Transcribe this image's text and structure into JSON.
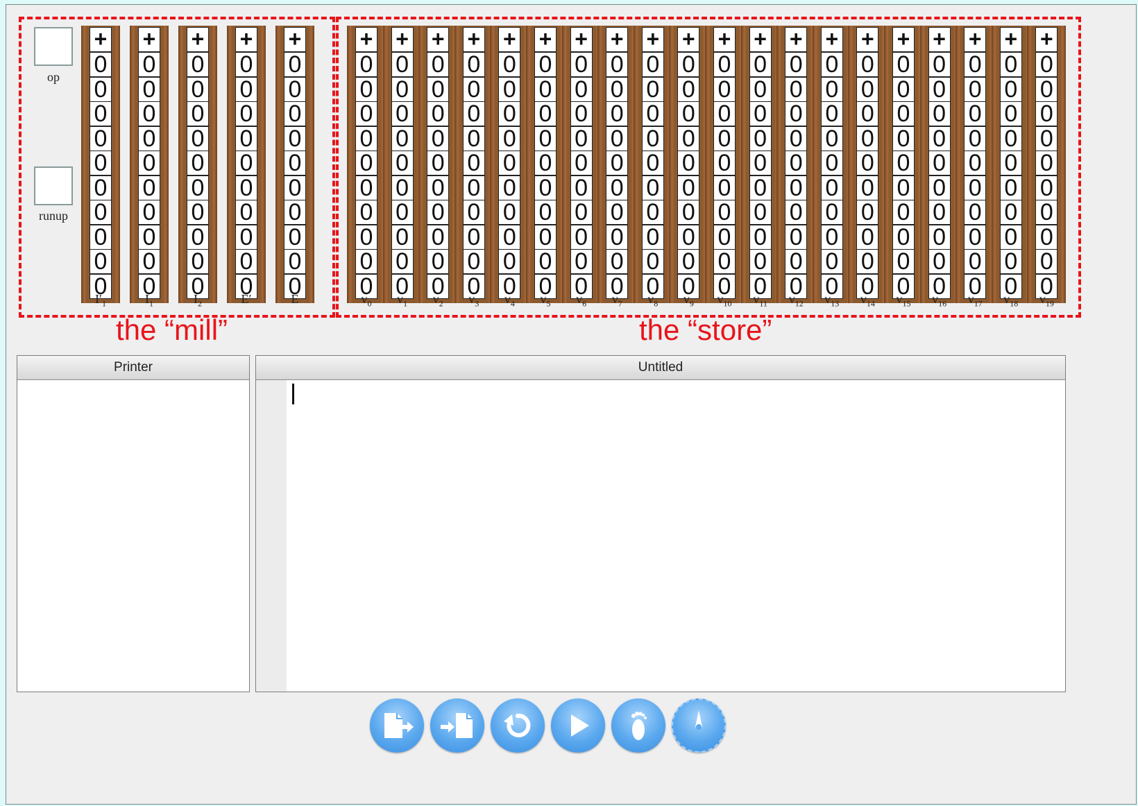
{
  "mill": {
    "caption": "the “mill”",
    "op_label": "op",
    "runup_label": "runup",
    "columns": [
      {
        "base": "I",
        "sub": "1",
        "prime": "′",
        "sign": "+",
        "digits": [
          "0",
          "0",
          "0",
          "0",
          "0",
          "0",
          "0",
          "0",
          "0",
          "0"
        ]
      },
      {
        "base": "I",
        "sub": "1",
        "prime": "",
        "sign": "+",
        "digits": [
          "0",
          "0",
          "0",
          "0",
          "0",
          "0",
          "0",
          "0",
          "0",
          "0"
        ]
      },
      {
        "base": "I",
        "sub": "2",
        "prime": "",
        "sign": "+",
        "digits": [
          "0",
          "0",
          "0",
          "0",
          "0",
          "0",
          "0",
          "0",
          "0",
          "0"
        ]
      },
      {
        "base": "E",
        "sub": "",
        "prime": "′",
        "sign": "+",
        "digits": [
          "0",
          "0",
          "0",
          "0",
          "0",
          "0",
          "0",
          "0",
          "0",
          "0"
        ]
      },
      {
        "base": "E",
        "sub": "",
        "prime": "",
        "sign": "+",
        "digits": [
          "0",
          "0",
          "0",
          "0",
          "0",
          "0",
          "0",
          "0",
          "0",
          "0"
        ]
      }
    ]
  },
  "store": {
    "caption": "the “store”",
    "columns": [
      {
        "base": "v",
        "sub": "0",
        "sign": "+"
      },
      {
        "base": "v",
        "sub": "1",
        "sign": "+"
      },
      {
        "base": "v",
        "sub": "2",
        "sign": "+"
      },
      {
        "base": "v",
        "sub": "3",
        "sign": "+"
      },
      {
        "base": "v",
        "sub": "4",
        "sign": "+"
      },
      {
        "base": "v",
        "sub": "5",
        "sign": "+"
      },
      {
        "base": "v",
        "sub": "6",
        "sign": "+"
      },
      {
        "base": "v",
        "sub": "7",
        "sign": "+"
      },
      {
        "base": "v",
        "sub": "8",
        "sign": "+"
      },
      {
        "base": "v",
        "sub": "9",
        "sign": "+"
      },
      {
        "base": "v",
        "sub": "10",
        "sign": "+"
      },
      {
        "base": "v",
        "sub": "11",
        "sign": "+"
      },
      {
        "base": "v",
        "sub": "12",
        "sign": "+"
      },
      {
        "base": "v",
        "sub": "13",
        "sign": "+"
      },
      {
        "base": "v",
        "sub": "14",
        "sign": "+"
      },
      {
        "base": "v",
        "sub": "15",
        "sign": "+"
      },
      {
        "base": "v",
        "sub": "16",
        "sign": "+"
      },
      {
        "base": "v",
        "sub": "17",
        "sign": "+"
      },
      {
        "base": "v",
        "sub": "18",
        "sign": "+"
      },
      {
        "base": "v",
        "sub": "19",
        "sign": "+"
      }
    ],
    "digit_value": "0",
    "digits_per_column": 10
  },
  "printer": {
    "title": "Printer",
    "content": ""
  },
  "editor": {
    "title": "Untitled",
    "content": ""
  },
  "controls": [
    {
      "name": "import-card-button",
      "icon": "card-arrow-out-icon"
    },
    {
      "name": "export-card-button",
      "icon": "card-arrow-in-icon"
    },
    {
      "name": "reset-button",
      "icon": "reset-arrow-icon"
    },
    {
      "name": "run-button",
      "icon": "play-icon"
    },
    {
      "name": "step-button",
      "icon": "footprint-icon"
    },
    {
      "name": "speed-button",
      "icon": "speed-dial-icon"
    }
  ],
  "colors": {
    "accent_red": "#e8141b",
    "column_brown": "#8c5a2e",
    "button_blue": "#5aa8ee"
  }
}
